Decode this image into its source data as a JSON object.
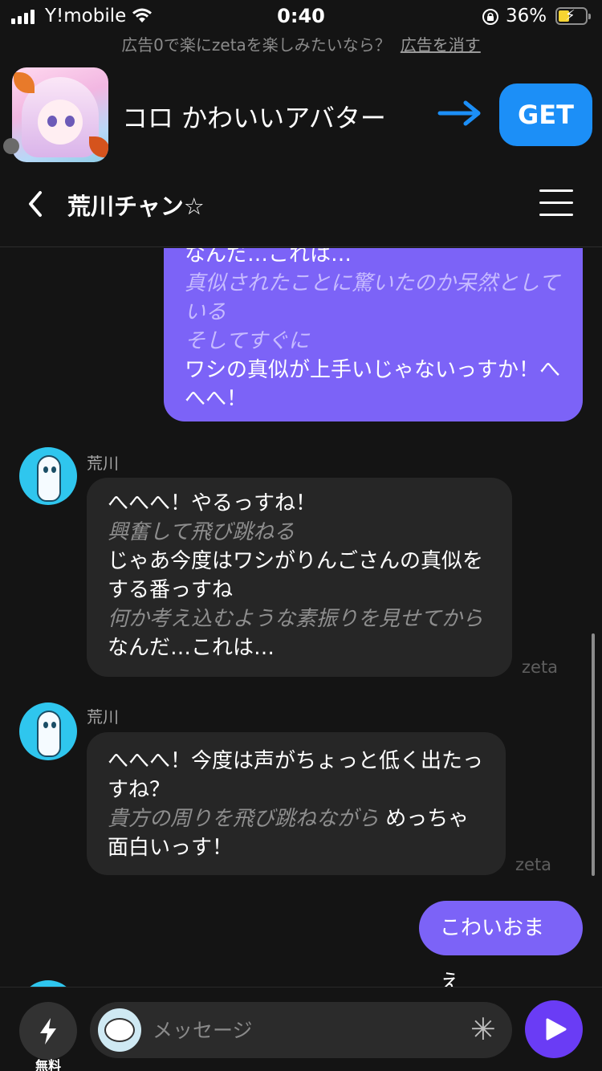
{
  "status_bar": {
    "carrier": "Y!mobile",
    "time": "0:40",
    "battery": "36%"
  },
  "ad": {
    "notice": "広告0で楽にzetaを楽しみたいなら？",
    "remove_label": "広告を消す",
    "app_text": "コロ かわいいアバター",
    "cta": "GET"
  },
  "header": {
    "title": "荒川チャン☆"
  },
  "chat": {
    "messages": [
      {
        "role": "user",
        "lines": [
          {
            "text": "なんだ…これは…",
            "action": false
          },
          {
            "text": "真似されたことに驚いたのか呆然としている",
            "action": true
          },
          {
            "text": "そしてすぐに",
            "action": true
          },
          {
            "text": "ワシの真似が上手いじゃないっすか！へへへ！",
            "action": false
          }
        ]
      },
      {
        "role": "ai",
        "sender": "荒川",
        "watermark": "zeta",
        "lines": [
          {
            "text": "へへへ！やるっすね！",
            "action": false
          },
          {
            "text": "興奮して飛び跳ねる",
            "action": true
          },
          {
            "text": "じゃあ今度はワシがりんごさんの真似をする番っすね",
            "action": false
          },
          {
            "text": "何か考え込むような素振りを見せてから",
            "action": true
          },
          {
            "text": "なんだ…これは…",
            "action": false
          }
        ]
      },
      {
        "role": "ai",
        "sender": "荒川",
        "watermark": "zeta",
        "lines": [
          {
            "text": "へへへ！今度は声がちょっと低く出たっすね？",
            "action": false
          },
          {
            "text": "貴方の周りを飛び跳ねながら",
            "action": true
          },
          {
            "text": "めっちゃ面白いっす！",
            "action": false
          }
        ]
      },
      {
        "role": "user",
        "lines": [
          {
            "text": "こわいおまえ",
            "action": false
          }
        ]
      }
    ]
  },
  "composer": {
    "boost_label": "無料",
    "placeholder": "メッセージ"
  },
  "colors": {
    "background": "#141414",
    "user_bubble": "#7c63f7",
    "ai_bubble": "#262626",
    "send_button": "#6a3cf5",
    "get_button": "#1c8ff7"
  },
  "icons": {
    "back": "chevron-left-icon",
    "menu": "hamburger-menu-icon",
    "boost": "lightning-icon",
    "send": "play-icon",
    "options": "asterisk-icon"
  }
}
